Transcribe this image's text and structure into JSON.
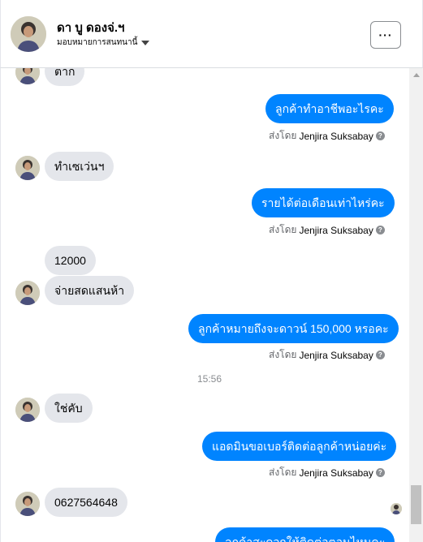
{
  "header": {
    "contact_name": "ดา บู ดองจ่.ฯ",
    "assign_label": "มอบหมายการสนทนานี้",
    "more_label": "···"
  },
  "messages": [
    {
      "dir": "in",
      "text": "ตาก"
    },
    {
      "dir": "out",
      "text": "ลูกค้าทำอาชีพอะไรคะ",
      "sender_prefix": "ส่งโดย",
      "sender_name": "Jenjira Suksabay"
    },
    {
      "dir": "in",
      "text": "ทำเซเว่นฯ"
    },
    {
      "dir": "out",
      "text": "รายได้ต่อเดือนเท่าไหร่คะ",
      "sender_prefix": "ส่งโดย",
      "sender_name": "Jenjira Suksabay"
    },
    {
      "dir": "in",
      "text": "12000"
    },
    {
      "dir": "in",
      "text": "จ่ายสดแสนห้า"
    },
    {
      "dir": "out",
      "text": "ลูกค้าหมายถึงจะดาวน์ 150,000 หรอคะ",
      "sender_prefix": "ส่งโดย",
      "sender_name": "Jenjira Suksabay"
    },
    {
      "dir": "in",
      "text": "ใช่คับ"
    },
    {
      "dir": "out",
      "text": "แอดมินขอเบอร์ติดต่อลูกค้าหน่อยค่ะ",
      "sender_prefix": "ส่งโดย",
      "sender_name": "Jenjira Suksabay"
    },
    {
      "dir": "in",
      "text": "0627564648"
    },
    {
      "dir": "out",
      "text": "ลูกค้าสะดวกให้ติดต่อตอนไหนคะ"
    }
  ],
  "timestamp": "15:56",
  "help_icon": "?",
  "colors": {
    "outgoing": "#0084ff",
    "incoming": "#e4e6eb",
    "meta": "#65676b"
  }
}
